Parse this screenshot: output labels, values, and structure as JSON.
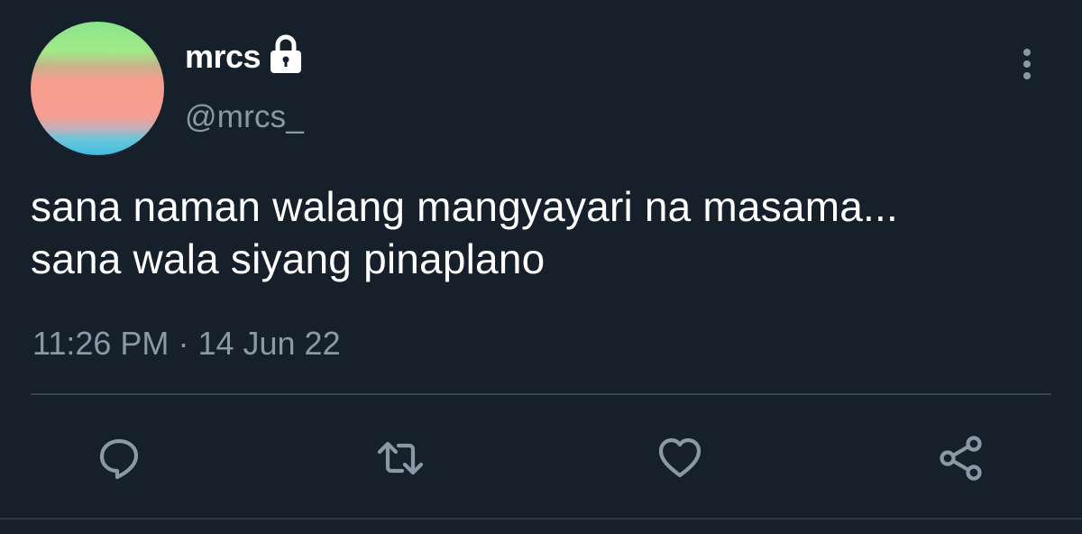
{
  "user": {
    "display_name": "mrcs",
    "handle": "@mrcs_",
    "protected_icon": "lock-icon",
    "avatar_colors": [
      "#9ee88e",
      "#f5a095",
      "#47bde0"
    ]
  },
  "tweet": {
    "lines": [
      "sana naman walang mangyayari na masama...",
      "sana wala siyang pinaplano"
    ],
    "time": "11:26 PM",
    "separator": "·",
    "date": "14 Jun 22"
  },
  "actions": [
    {
      "name": "reply",
      "icon": "reply-icon"
    },
    {
      "name": "retweet",
      "icon": "retweet-icon"
    },
    {
      "name": "like",
      "icon": "heart-icon"
    },
    {
      "name": "share",
      "icon": "share-icon"
    }
  ],
  "colors": {
    "background": "#15202b",
    "text": "#ffffff",
    "secondary": "#8b98a5",
    "divider": "#38444d"
  }
}
